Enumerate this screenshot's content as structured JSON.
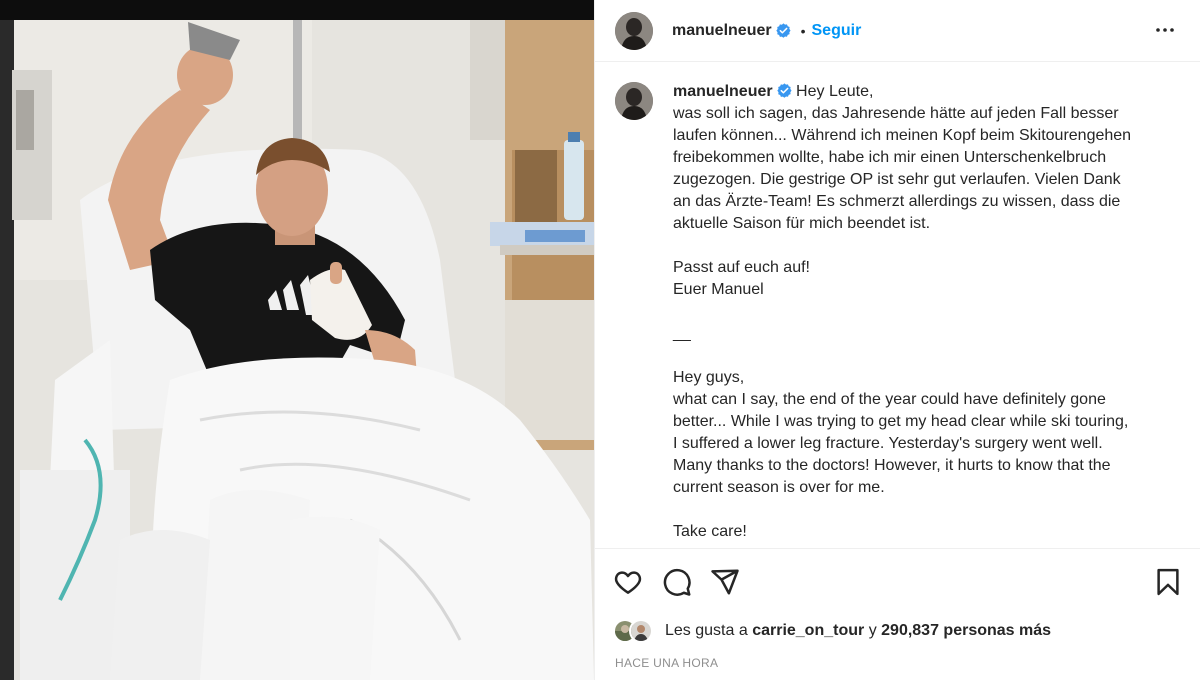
{
  "header": {
    "username": "manuelneuer",
    "separator": "•",
    "follow_label": "Seguir",
    "verified_icon": "verified-badge-icon",
    "more_icon": "more-options-icon"
  },
  "caption": {
    "username": "manuelneuer",
    "lines": [
      "Hey Leute,",
      "was soll ich sagen, das Jahresende hätte auf jeden Fall besser",
      "laufen können... Während ich meinen Kopf beim Skitourengehen",
      "freibekommen wollte, habe ich mir einen Unterschenkelbruch",
      "zugezogen. Die gestrige OP ist sehr gut verlaufen. Vielen Dank",
      "an das Ärzte-Team! Es schmerzt allerdings zu wissen, dass die",
      "aktuelle Saison für mich beendet ist.",
      "",
      "Passt auf euch auf!",
      "Euer Manuel",
      "",
      "__",
      "",
      "Hey guys,",
      "what can I say, the end of the year could have definitely gone",
      "better... While I was trying to get my head clear while ski touring,",
      "I suffered a lower leg fracture. Yesterday's surgery went well.",
      "Many thanks to the doctors! However, it hurts to know that the",
      "current season is over for me.",
      "",
      "Take care!"
    ]
  },
  "actions": {
    "icons": [
      "heart-icon",
      "comment-icon",
      "share-icon",
      "bookmark-icon"
    ]
  },
  "likes": {
    "prefix": "Les gusta a",
    "user": "carrie_on_tour",
    "connector": "y",
    "count": "290,837 personas más"
  },
  "timestamp": "HACE UNA HORA",
  "colors": {
    "accent": "#0095f6",
    "text": "#262626",
    "secondary": "#8e8e8e",
    "border": "#efefef"
  }
}
